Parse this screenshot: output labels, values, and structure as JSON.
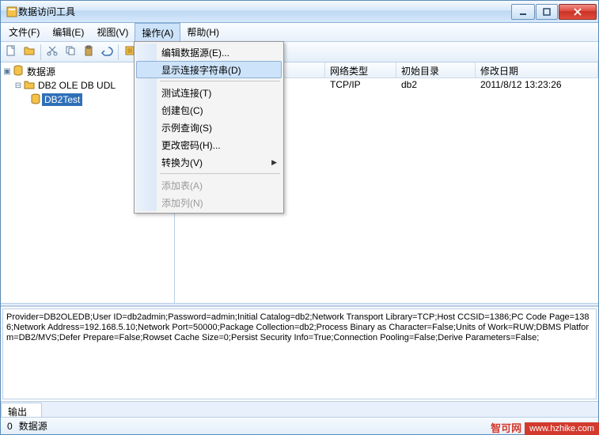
{
  "window": {
    "title": "数据访问工具"
  },
  "menubar": {
    "file": "文件(F)",
    "edit": "编辑(E)",
    "view": "视图(V)",
    "action": "操作(A)",
    "help": "帮助(H)"
  },
  "dropdown": {
    "edit_datasource": "编辑数据源(E)...",
    "show_connstr": "显示连接字符串(D)",
    "test_conn": "测试连接(T)",
    "create_pkg": "创建包(C)",
    "sample_query": "示例查询(S)",
    "change_pwd": "更改密码(H)...",
    "convert_to": "转换为(V)",
    "add_table": "添加表(A)",
    "add_column": "添加列(N)"
  },
  "tree": {
    "root": "数据源",
    "node1": "DB2 OLE DB UDL",
    "node2": "DB2Test"
  },
  "list": {
    "headers": {
      "c1": "",
      "c2": "网络类型",
      "c3": "初始目录",
      "c4": "修改日期"
    },
    "rows": [
      {
        "c1": "",
        "c2": "TCP/IP",
        "c3": "db2",
        "c4": "2011/8/12 13:23:26"
      }
    ]
  },
  "connstr": "Provider=DB2OLEDB;User ID=db2admin;Password=admin;Initial Catalog=db2;Network Transport Library=TCP;Host CCSID=1386;PC Code Page=1386;Network Address=192.168.5.10;Network Port=50000;Package Collection=db2;Process Binary as Character=False;Units of Work=RUW;DBMS Platform=DB2/MVS;Defer Prepare=False;Rowset Cache Size=0;Persist Security Info=True;Connection Pooling=False;Derive Parameters=False;",
  "output_tab": "输出",
  "status": {
    "count": "0",
    "label": "数据源"
  },
  "watermark": {
    "cn": "智可网",
    "url": "www.hzhike.com"
  }
}
